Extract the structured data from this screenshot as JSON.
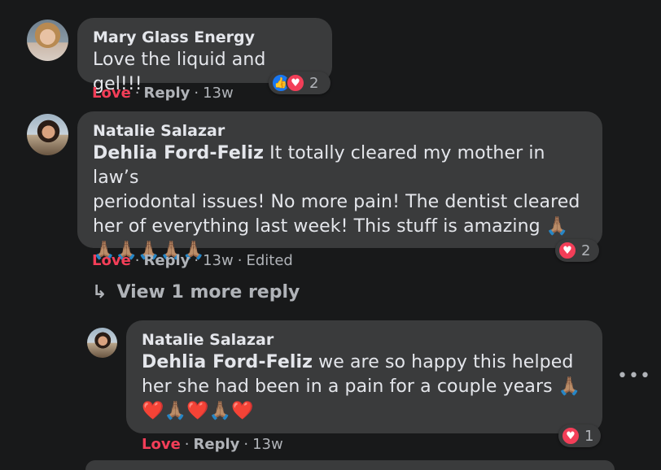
{
  "comments": [
    {
      "author": "Mary Glass Energy",
      "text": "Love the liquid and gel!!!",
      "actions": {
        "love": "Love",
        "reply": "Reply",
        "time": "13w"
      },
      "reactions": {
        "count": "2",
        "icons": [
          "like-icon",
          "heart-icon"
        ]
      }
    },
    {
      "author": "Natalie Salazar",
      "mention": "Dehlia Ford-Feliz",
      "text_line1": " It totally cleared my mother in law’s",
      "text_line2": "periodontal issues! No more pain! The dentist cleared",
      "text_line3": "her of everything last week! This stuff is amazing 🙏🏽",
      "text_line4": "🙏🏽🙏🏽🙏🏽🙏🏽🙏🏽",
      "actions": {
        "love": "Love",
        "reply": "Reply",
        "time": "13w",
        "edited": "Edited"
      },
      "reactions": {
        "count": "2",
        "icons": [
          "heart-icon"
        ]
      }
    }
  ],
  "view_more": {
    "label": "View 1 more reply",
    "arrow": "↳"
  },
  "reply": {
    "author": "Natalie Salazar",
    "mention": "Dehlia Ford-Feliz",
    "text_line1": " we are so happy this helped",
    "text_line2": "her she had been in a pain for a couple years 🙏🏽",
    "text_line3": "❤️🙏🏽❤️🙏🏽❤️",
    "actions": {
      "love": "Love",
      "reply": "Reply",
      "time": "13w"
    },
    "reactions": {
      "count": "1",
      "icons": [
        "heart-icon"
      ]
    }
  },
  "more_options": "•••",
  "colors": {
    "background": "#18191a",
    "bubble": "#3a3b3c",
    "love": "#f33e58",
    "like": "#1877f2",
    "muted": "#b0b3b8"
  }
}
